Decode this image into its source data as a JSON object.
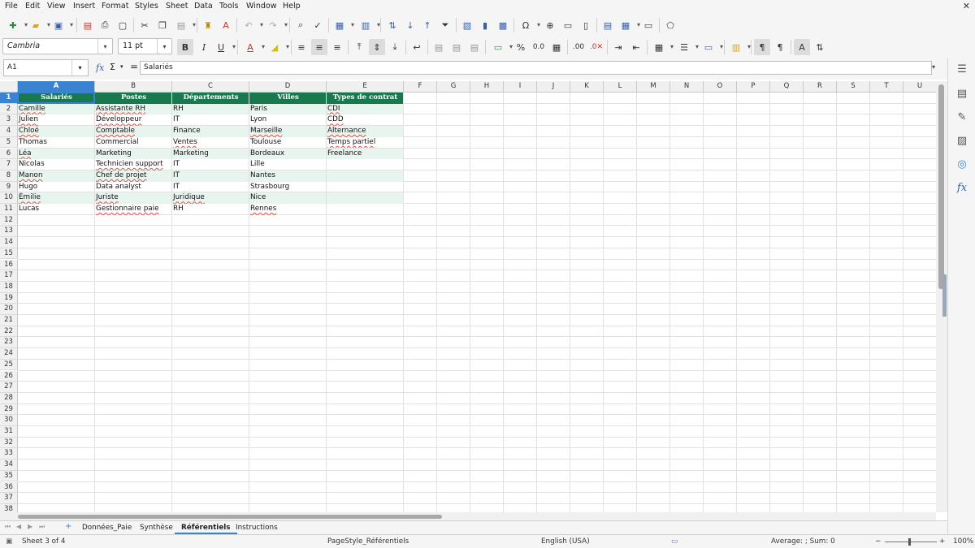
{
  "menu": [
    "File",
    "Edit",
    "View",
    "Insert",
    "Format",
    "Styles",
    "Sheet",
    "Data",
    "Tools",
    "Window",
    "Help"
  ],
  "font": {
    "name": "Cambria",
    "size": "11 pt"
  },
  "namebox": "A1",
  "formula": "Salariés",
  "columns": [
    "A",
    "B",
    "C",
    "D",
    "E",
    "F",
    "G",
    "H",
    "I",
    "J",
    "K",
    "L",
    "M",
    "N",
    "O",
    "P",
    "Q",
    "R",
    "S",
    "T",
    "U"
  ],
  "rows": [
    "1",
    "2",
    "3",
    "4",
    "5",
    "6",
    "7",
    "8",
    "9",
    "10",
    "11",
    "12",
    "13",
    "14",
    "15",
    "16",
    "17",
    "18",
    "19",
    "20",
    "21",
    "22",
    "23",
    "24",
    "25",
    "26",
    "27",
    "28",
    "29",
    "30",
    "31",
    "32",
    "33",
    "34",
    "35",
    "36",
    "37",
    "38"
  ],
  "table": {
    "headers": [
      "Salariés",
      "Postes",
      "Départements",
      "Villes",
      "Types de contrat"
    ],
    "rows": [
      [
        "Camille",
        "Assistante RH",
        "RH",
        "Paris",
        "CDI"
      ],
      [
        "Julien",
        "Développeur",
        "IT",
        "Lyon",
        "CDD"
      ],
      [
        "Chloé",
        "Comptable",
        "Finance",
        "Marseille",
        "Alternance"
      ],
      [
        "Thomas",
        "Commercial",
        "Ventes",
        "Toulouse",
        "Temps partiel"
      ],
      [
        "Léa",
        "Marketing",
        "Marketing",
        "Bordeaux",
        "Freelance"
      ],
      [
        "Nicolas",
        "Technicien support",
        "IT",
        "Lille",
        ""
      ],
      [
        "Manon",
        "Chef de projet",
        "IT",
        "Nantes",
        ""
      ],
      [
        "Hugo",
        "Data analyst",
        "IT",
        "Strasbourg",
        ""
      ],
      [
        "Émilie",
        "Juriste",
        "Juridique",
        "Nice",
        ""
      ],
      [
        "Lucas",
        "Gestionnaire paie",
        "RH",
        "Rennes",
        ""
      ]
    ]
  },
  "sheets": [
    "Données_Paie",
    "Synthèse",
    "Référentiels",
    "Instructions"
  ],
  "active_sheet": "Référentiels",
  "status": {
    "sheet": "Sheet 3 of 4",
    "page_style": "PageStyle_Référentiels",
    "language": "English (USA)",
    "summary": "Average: ; Sum: 0",
    "zoom": "100%"
  },
  "colors": {
    "header_bg": "#18794e",
    "alt_row_bg": "#e8f5ee",
    "selection": "#3a83d1"
  }
}
